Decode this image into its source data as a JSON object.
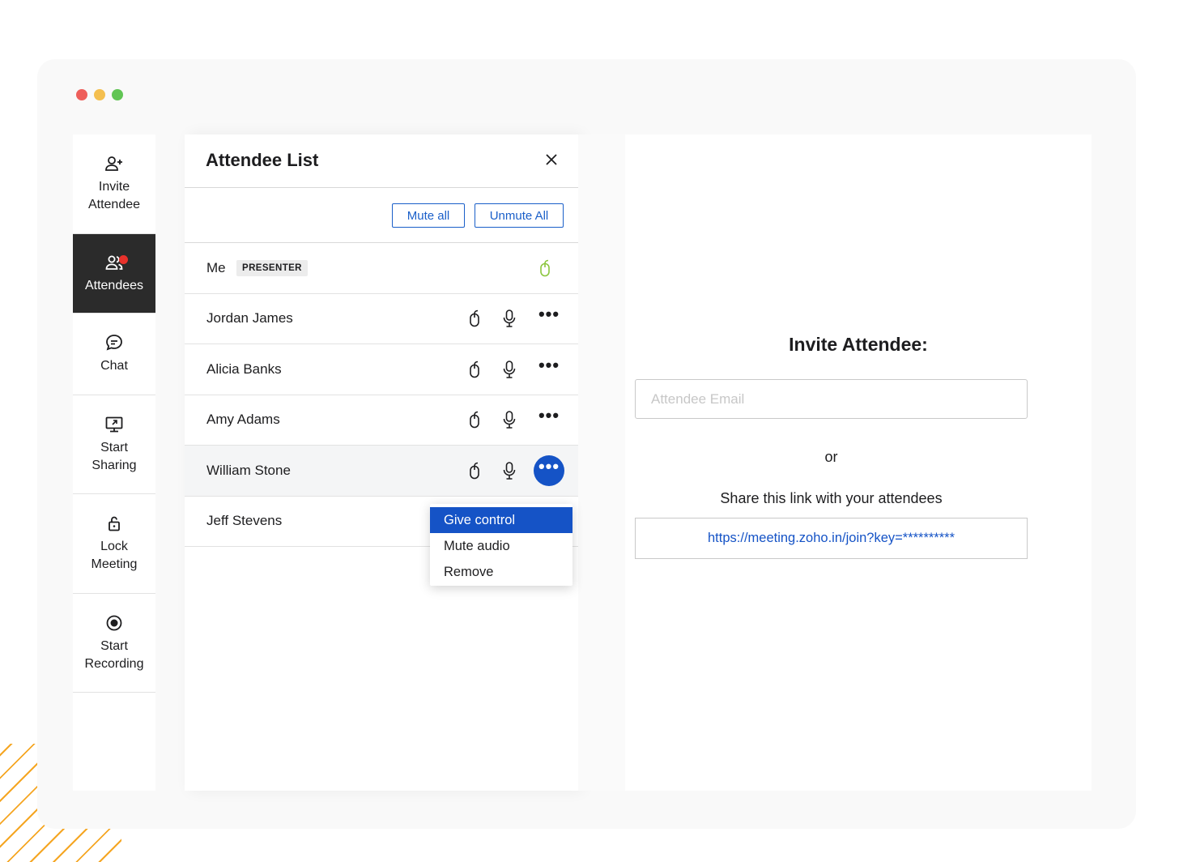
{
  "sidebar": {
    "items": [
      {
        "label": "Invite\nAttendee",
        "icon": "add-user-icon"
      },
      {
        "label": "Attendees",
        "icon": "attendees-icon",
        "active": true,
        "notification": true
      },
      {
        "label": "Chat",
        "icon": "chat-icon"
      },
      {
        "label": "Start\nSharing",
        "icon": "screen-share-icon"
      },
      {
        "label": "Lock\nMeeting",
        "icon": "lock-icon"
      },
      {
        "label": "Start\nRecording",
        "icon": "record-icon"
      }
    ]
  },
  "attendee_panel": {
    "title": "Attendee List",
    "mute_all_label": "Mute all",
    "unmute_all_label": "Unmute All",
    "presenter_badge": "PRESENTER",
    "attendees": [
      {
        "name": "Me",
        "role": "presenter",
        "control_icon": "mouse-icon",
        "control_color": "#8cc63f"
      },
      {
        "name": "Jordan James"
      },
      {
        "name": "Alicia Banks"
      },
      {
        "name": "Amy Adams"
      },
      {
        "name": "William Stone",
        "menu_open": true
      },
      {
        "name": "Jeff Stevens"
      }
    ]
  },
  "context_menu": {
    "items": [
      "Give control",
      "Mute audio",
      "Remove"
    ],
    "selected": "Give control"
  },
  "invite": {
    "title": "Invite Attendee:",
    "email_placeholder": "Attendee Email",
    "or_label": "or",
    "share_text": "Share this link with your attendees",
    "link": "https://meeting.zoho.in/join?key=**********"
  },
  "colors": {
    "accent": "#1553c6",
    "active_sidebar": "#2b2b2b",
    "notification": "#e8312b",
    "presenter_control": "#8cc63f"
  }
}
